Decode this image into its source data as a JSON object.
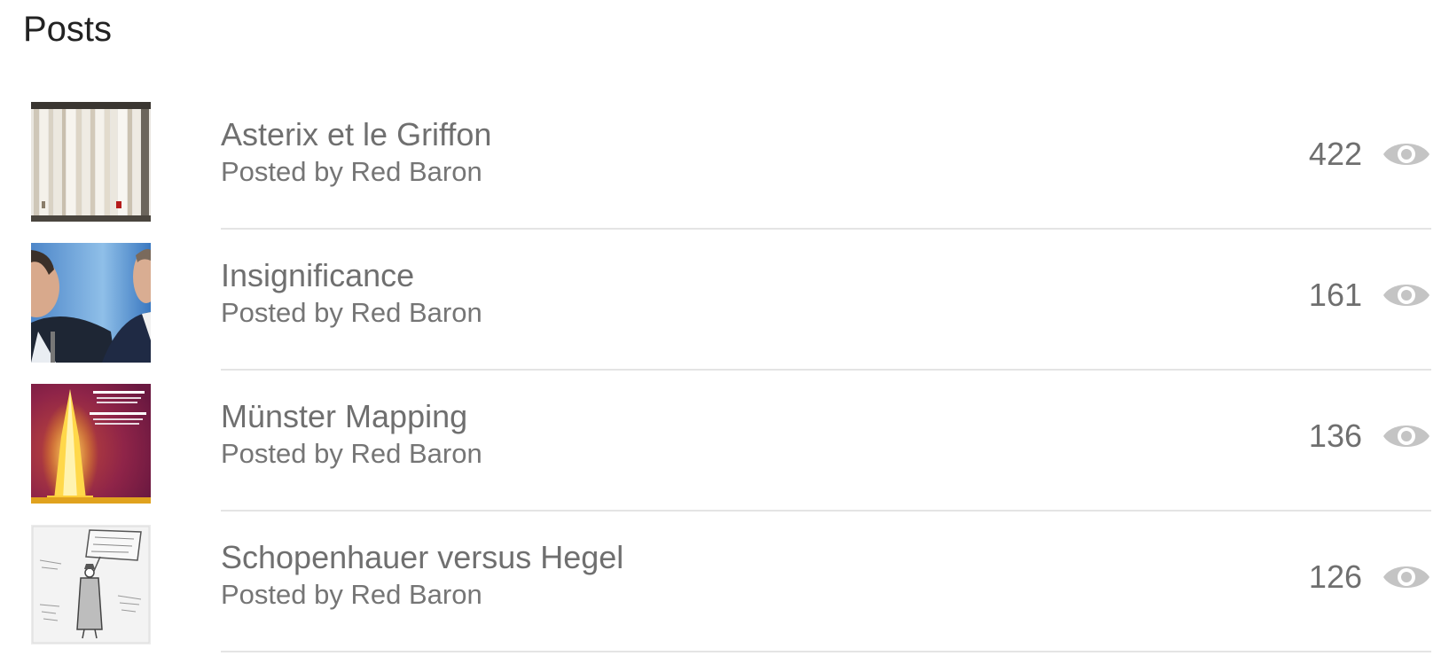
{
  "page": {
    "title": "Posts"
  },
  "posts": [
    {
      "title": "Asterix et le Griffon",
      "byline": "Posted by Red Baron",
      "views": "422",
      "thumbnail": "bookshelf-spines-image",
      "view_icon": "eye-icon"
    },
    {
      "title": "Insignificance",
      "byline": "Posted by Red Baron",
      "views": "161",
      "thumbnail": "two-politicians-photo",
      "view_icon": "eye-icon"
    },
    {
      "title": "Münster Mapping",
      "byline": "Posted by Red Baron",
      "views": "136",
      "thumbnail": "illuminated-tower-poster",
      "view_icon": "eye-icon"
    },
    {
      "title": "Schopenhauer versus Hegel",
      "byline": "Posted by Red Baron",
      "views": "126",
      "thumbnail": "protest-sign-cartoon",
      "view_icon": "eye-icon"
    }
  ],
  "colors": {
    "title_text": "#222222",
    "item_text": "#6f6f6f",
    "icon": "#c4c4c4",
    "divider": "#e4e4e4"
  }
}
